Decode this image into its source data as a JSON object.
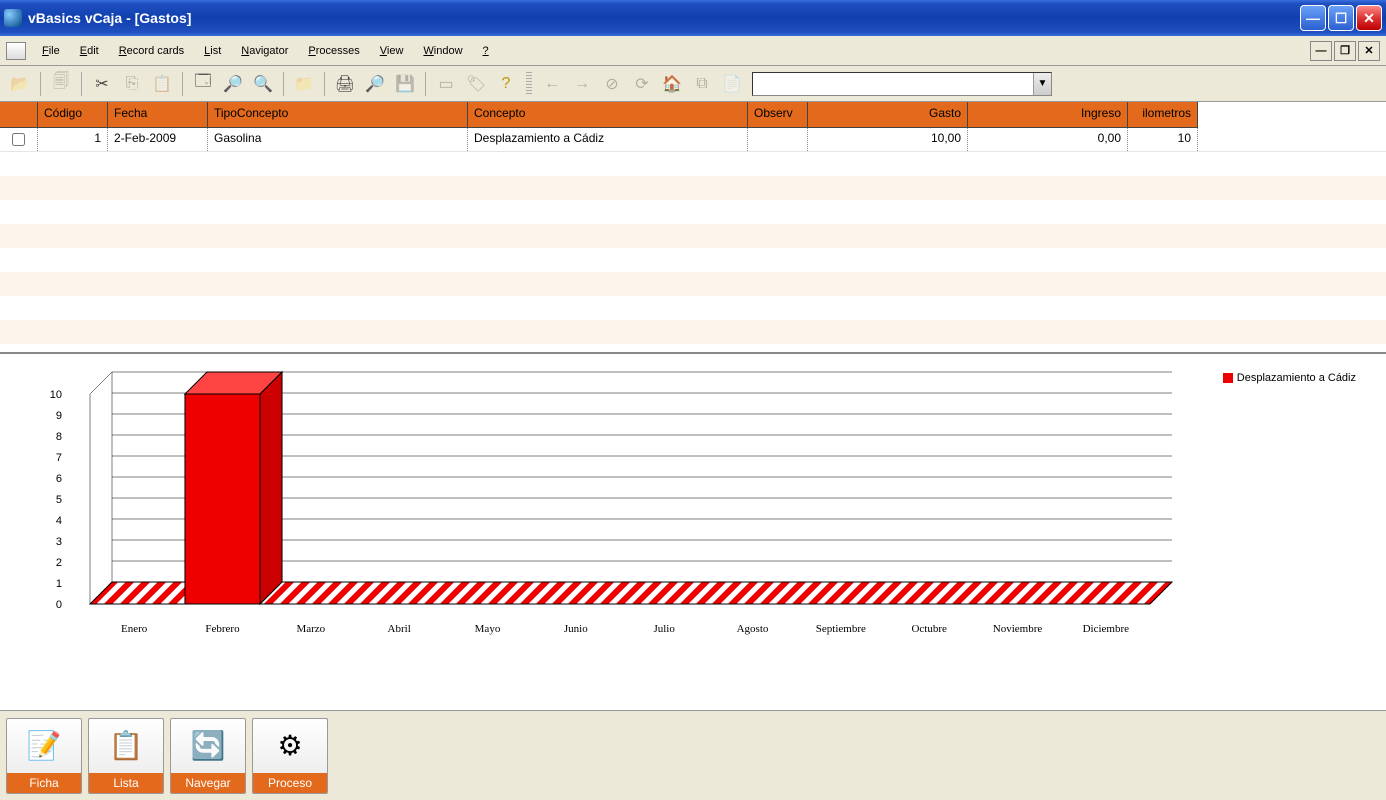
{
  "window": {
    "title": "vBasics vCaja - [Gastos]"
  },
  "menu": {
    "items": [
      "File",
      "Edit",
      "Record cards",
      "List",
      "Navigator",
      "Processes",
      "View",
      "Window",
      "?"
    ]
  },
  "toolbar": {
    "search_value": ""
  },
  "grid": {
    "headers": {
      "codigo": "Código",
      "fecha": "Fecha",
      "tipo": "TipoConcepto",
      "concepto": "Concepto",
      "observ": "Observ",
      "gasto": "Gasto",
      "ingreso": "Ingreso",
      "km": "ilometros"
    },
    "rows": [
      {
        "checked": false,
        "codigo": "1",
        "fecha": "2-Feb-2009",
        "tipo": "Gasolina",
        "concepto": "Desplazamiento a Cádiz",
        "observ": "",
        "gasto": "10,00",
        "ingreso": "0,00",
        "km": "10"
      }
    ]
  },
  "chart_data": {
    "type": "bar",
    "categories": [
      "Enero",
      "Febrero",
      "Marzo",
      "Abril",
      "Mayo",
      "Junio",
      "Julio",
      "Agosto",
      "Septiembre",
      "Octubre",
      "Noviembre",
      "Diciembre"
    ],
    "series": [
      {
        "name": "Desplazamiento a Cádiz",
        "values": [
          0,
          10,
          0,
          0,
          0,
          0,
          0,
          0,
          0,
          0,
          0,
          0
        ],
        "color": "#e00000"
      }
    ],
    "ylim": [
      0,
      10
    ],
    "yticks": [
      0,
      1,
      2,
      3,
      4,
      5,
      6,
      7,
      8,
      9,
      10
    ],
    "legend_position": "top-right"
  },
  "bottom_tabs": {
    "ficha": "Ficha",
    "lista": "Lista",
    "navegar": "Navegar",
    "proceso": "Proceso"
  }
}
